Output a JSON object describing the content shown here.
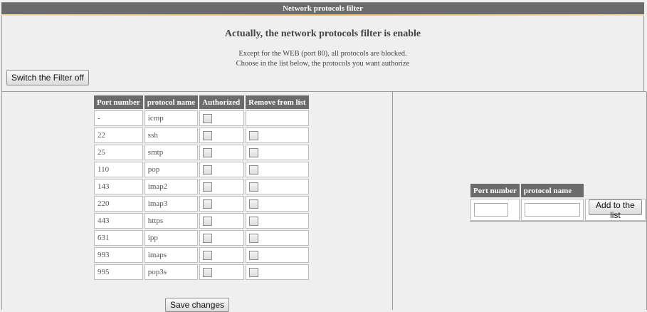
{
  "header": {
    "title": "Network protocols filter"
  },
  "status": {
    "heading": "Actually, the network protocols filter is enable",
    "line1": "Except for the WEB (port 80), all protocols are blocked.",
    "line2": "Choose in the list below, the protocols you want authorize",
    "switch_button": "Switch the Filter off"
  },
  "protocols": {
    "headers": [
      "Port number",
      "protocol name",
      "Authorized",
      "Remove from list"
    ],
    "rows": [
      {
        "port": "-",
        "name": "icmp",
        "authorized": false,
        "removable": false
      },
      {
        "port": "22",
        "name": "ssh",
        "authorized": false,
        "removable": true
      },
      {
        "port": "25",
        "name": "smtp",
        "authorized": false,
        "removable": true
      },
      {
        "port": "110",
        "name": "pop",
        "authorized": false,
        "removable": true
      },
      {
        "port": "143",
        "name": "imap2",
        "authorized": false,
        "removable": true
      },
      {
        "port": "220",
        "name": "imap3",
        "authorized": false,
        "removable": true
      },
      {
        "port": "443",
        "name": "https",
        "authorized": false,
        "removable": true
      },
      {
        "port": "631",
        "name": "ipp",
        "authorized": false,
        "removable": true
      },
      {
        "port": "993",
        "name": "imaps",
        "authorized": false,
        "removable": true
      },
      {
        "port": "995",
        "name": "pop3s",
        "authorized": false,
        "removable": true
      }
    ],
    "save_button": "Save changes"
  },
  "add_form": {
    "headers": [
      "Port number",
      "protocol name"
    ],
    "port_value": "",
    "name_value": "",
    "add_button": "Add to the list"
  }
}
